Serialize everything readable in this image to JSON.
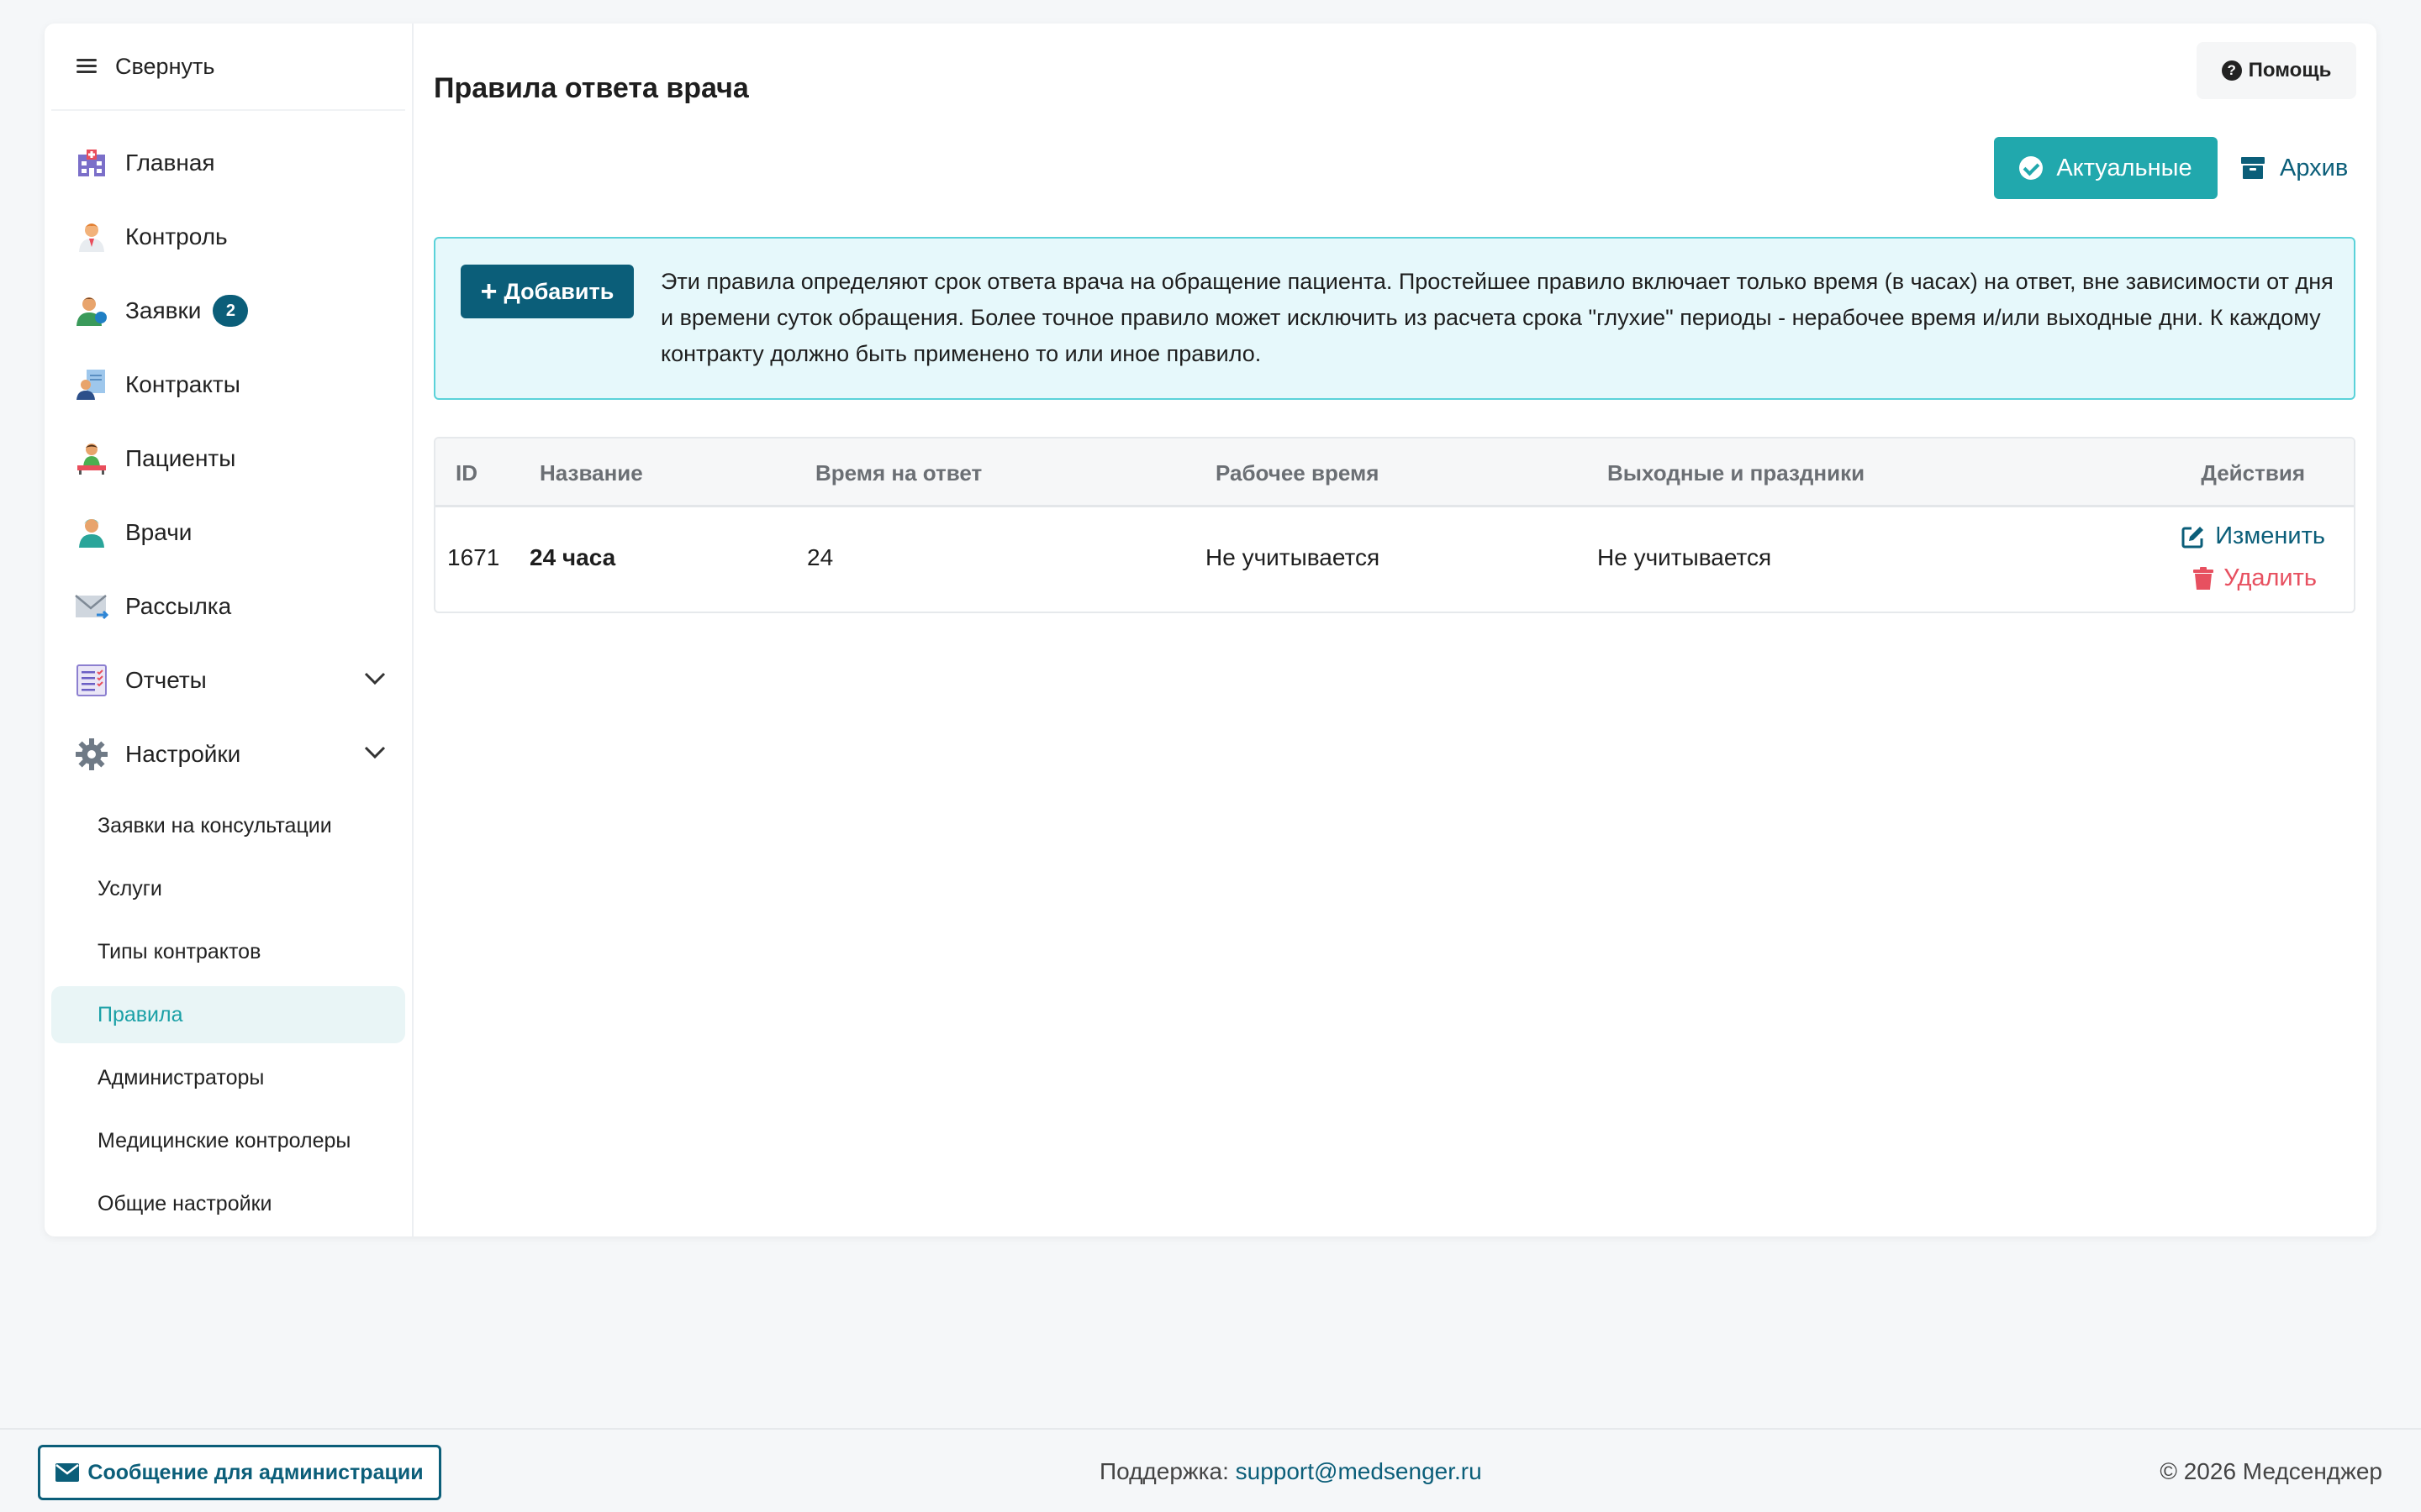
{
  "sidebar": {
    "collapse_label": "Свернуть",
    "items": [
      {
        "label": "Главная",
        "icon": "hospital-icon"
      },
      {
        "label": "Контроль",
        "icon": "doctor-icon"
      },
      {
        "label": "Заявки",
        "icon": "user-requests-icon",
        "badge": "2"
      },
      {
        "label": "Контракты",
        "icon": "contracts-icon"
      },
      {
        "label": "Пациенты",
        "icon": "patients-icon"
      },
      {
        "label": "Врачи",
        "icon": "doctors-icon"
      },
      {
        "label": "Рассылка",
        "icon": "mail-icon"
      },
      {
        "label": "Отчеты",
        "icon": "reports-icon"
      },
      {
        "label": "Настройки",
        "icon": "gear-icon"
      }
    ],
    "subitems": [
      "Заявки на консультации",
      "Услуги",
      "Типы контрактов",
      "Правила",
      "Администраторы",
      "Медицинские контролеры",
      "Общие настройки"
    ],
    "active_subitem": "Правила"
  },
  "header": {
    "title": "Правила ответа врача",
    "help_label": "Помощь"
  },
  "filters": {
    "actual_label": "Актуальные",
    "archive_label": "Архив"
  },
  "info": {
    "add_label": "Добавить",
    "text": "Эти правила определяют срок ответа врача на обращение пациента. Простейшее правило включает только время (в часах) на ответ, вне зависимости от дня и времени суток обращения. Более точное правило может исключить из расчета срока \"глухие\" периоды - нерабочее время и/или выходные дни. К каждому контракту должно быть применено то или иное правило."
  },
  "table": {
    "headers": {
      "id": "ID",
      "name": "Название",
      "time": "Время на ответ",
      "work": "Рабочее время",
      "holidays": "Выходные и праздники",
      "actions": "Действия"
    },
    "rows": [
      {
        "id": "1671",
        "name": "24 часа",
        "time": "24",
        "work": "Не учитывается",
        "holidays": "Не учитывается",
        "edit": "Изменить",
        "delete": "Удалить"
      }
    ]
  },
  "footer": {
    "message_button": "Сообщение для администрации",
    "support_label": "Поддержка:",
    "support_email": "support@medsenger.ru",
    "copyright": "© 2026 Медсенджер"
  },
  "colors": {
    "primary": "#0b5e79",
    "accent": "#21a8ad",
    "danger": "#e75060",
    "info_bg": "#e6f8fb"
  }
}
